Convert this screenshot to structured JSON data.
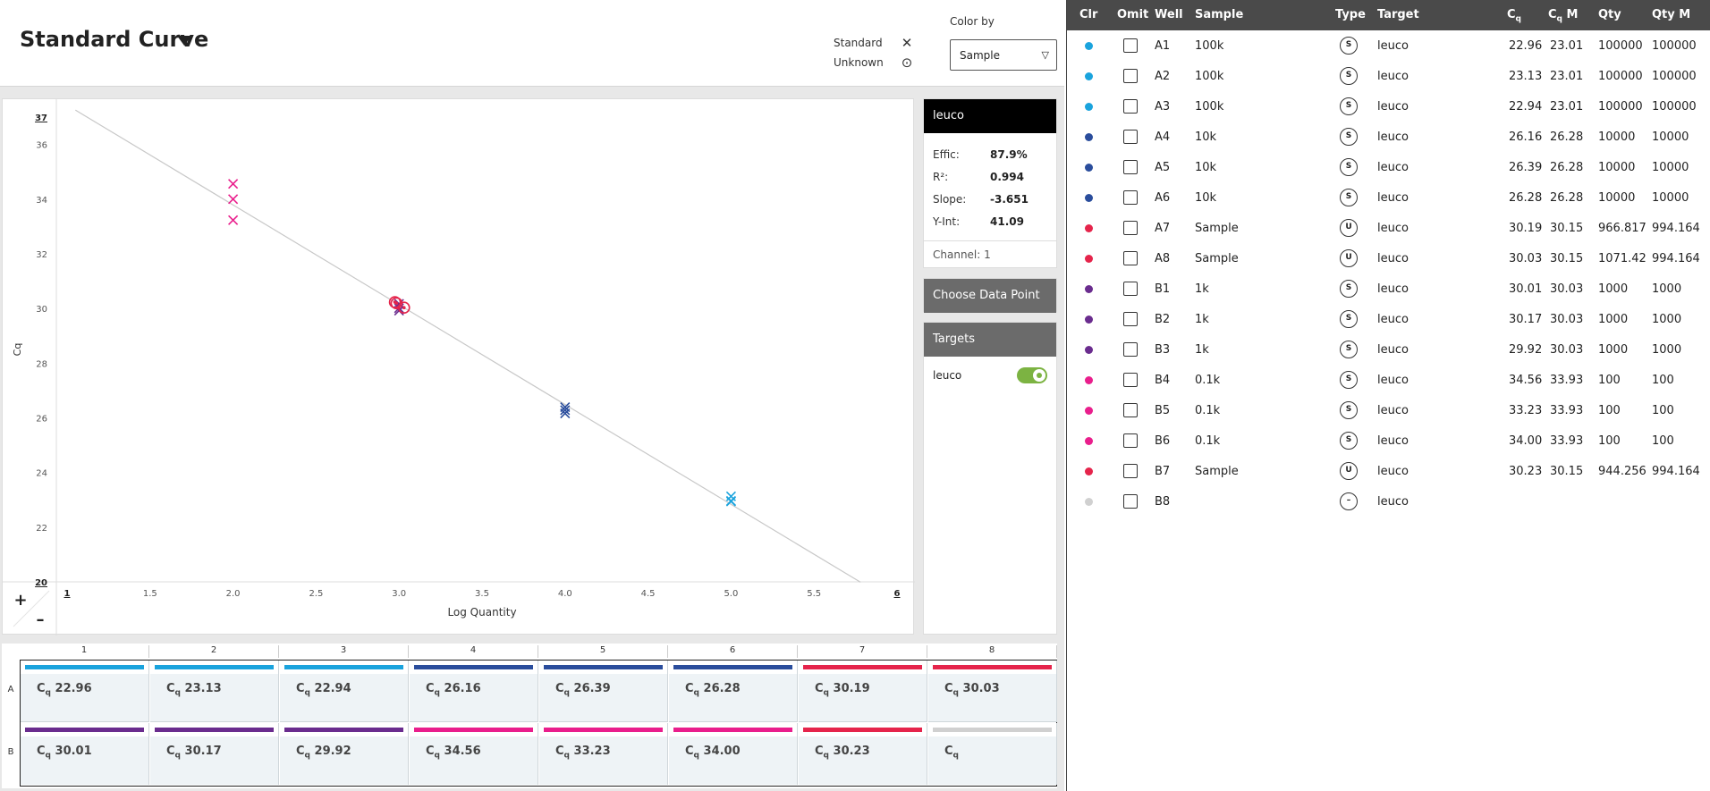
{
  "header": {
    "title": "Standard Curve",
    "legend": {
      "standard_label": "Standard",
      "unknown_label": "Unknown"
    },
    "color_by": {
      "label": "Color by",
      "value": "Sample"
    }
  },
  "side_panel": {
    "target_name": "leuco",
    "stats": [
      {
        "key": "Effic:",
        "value": "87.9%"
      },
      {
        "key": "R²:",
        "value": "0.994"
      },
      {
        "key": "Slope:",
        "value": "-3.651"
      },
      {
        "key": "Y-Int:",
        "value": "41.09"
      }
    ],
    "channel": "Channel: 1",
    "choose_point_label": "Choose Data Point",
    "targets_label": "Targets",
    "target_toggle": {
      "label": "leuco",
      "on": true
    }
  },
  "zoom": {
    "in": "+",
    "out": "–"
  },
  "chart_data": {
    "type": "scatter",
    "xlabel": "Log Quantity",
    "ylabel": "Cq",
    "xlim": [
      1,
      6
    ],
    "ylim": [
      20,
      37
    ],
    "x_ticks": [
      "1",
      "1.5",
      "2.0",
      "2.5",
      "3.0",
      "3.5",
      "4.0",
      "4.5",
      "5.0",
      "5.5",
      "6"
    ],
    "y_ticks": [
      "20",
      "22",
      "24",
      "26",
      "28",
      "30",
      "32",
      "34",
      "36",
      "37"
    ],
    "fit_line": {
      "slope": -3.651,
      "intercept": 41.09
    },
    "points": [
      {
        "x": 5.0,
        "y": 22.96,
        "type": "standard",
        "color": "#1aa3dd"
      },
      {
        "x": 5.0,
        "y": 23.13,
        "type": "standard",
        "color": "#1aa3dd"
      },
      {
        "x": 5.0,
        "y": 22.94,
        "type": "standard",
        "color": "#1aa3dd"
      },
      {
        "x": 4.0,
        "y": 26.16,
        "type": "standard",
        "color": "#2a4d9c"
      },
      {
        "x": 4.0,
        "y": 26.39,
        "type": "standard",
        "color": "#2a4d9c"
      },
      {
        "x": 4.0,
        "y": 26.28,
        "type": "standard",
        "color": "#2a4d9c"
      },
      {
        "x": 3.0,
        "y": 30.01,
        "type": "standard",
        "color": "#6a2c8e"
      },
      {
        "x": 3.0,
        "y": 30.17,
        "type": "standard",
        "color": "#6a2c8e"
      },
      {
        "x": 3.0,
        "y": 29.92,
        "type": "standard",
        "color": "#6a2c8e"
      },
      {
        "x": 2.0,
        "y": 34.56,
        "type": "standard",
        "color": "#e91e8c"
      },
      {
        "x": 2.0,
        "y": 33.23,
        "type": "standard",
        "color": "#e91e8c"
      },
      {
        "x": 2.0,
        "y": 34.0,
        "type": "standard",
        "color": "#e91e8c"
      },
      {
        "x": 2.985,
        "y": 30.19,
        "type": "unknown",
        "color": "#e5244b"
      },
      {
        "x": 3.03,
        "y": 30.03,
        "type": "unknown",
        "color": "#e5244b"
      },
      {
        "x": 2.975,
        "y": 30.23,
        "type": "unknown",
        "color": "#e5244b"
      }
    ]
  },
  "plate": {
    "columns": [
      "1",
      "2",
      "3",
      "4",
      "5",
      "6",
      "7",
      "8"
    ],
    "rows": [
      "A",
      "B"
    ],
    "wells": [
      [
        {
          "cq": " 22.96",
          "color": "#1aa3dd"
        },
        {
          "cq": " 23.13",
          "color": "#1aa3dd"
        },
        {
          "cq": " 22.94",
          "color": "#1aa3dd"
        },
        {
          "cq": " 26.16",
          "color": "#2a4d9c"
        },
        {
          "cq": " 26.39",
          "color": "#2a4d9c"
        },
        {
          "cq": " 26.28",
          "color": "#2a4d9c"
        },
        {
          "cq": " 30.19",
          "color": "#e5244b"
        },
        {
          "cq": " 30.03",
          "color": "#e5244b"
        }
      ],
      [
        {
          "cq": " 30.01",
          "color": "#6a2c8e"
        },
        {
          "cq": " 30.17",
          "color": "#6a2c8e"
        },
        {
          "cq": " 29.92",
          "color": "#6a2c8e"
        },
        {
          "cq": " 34.56",
          "color": "#e91e8c"
        },
        {
          "cq": " 33.23",
          "color": "#e91e8c"
        },
        {
          "cq": " 34.00",
          "color": "#e91e8c"
        },
        {
          "cq": " 30.23",
          "color": "#e5244b"
        },
        {
          "cq": "",
          "color": "#d0d0d0"
        }
      ]
    ]
  },
  "table": {
    "headers": {
      "clr": "Clr",
      "omit": "Omit",
      "well": "Well",
      "sample": "Sample",
      "type": "Type",
      "target": "Target",
      "cq": "C",
      "cq_m": "C",
      "qty": "Qty",
      "qty_m": "Qty M"
    },
    "rows": [
      {
        "color": "#1aa3dd",
        "well": "A1",
        "sample": "100k",
        "type": "S",
        "target": "leuco",
        "cq": "22.96",
        "cq_m": "23.01",
        "qty": "100000",
        "qty_m": "100000"
      },
      {
        "color": "#1aa3dd",
        "well": "A2",
        "sample": "100k",
        "type": "S",
        "target": "leuco",
        "cq": "23.13",
        "cq_m": "23.01",
        "qty": "100000",
        "qty_m": "100000"
      },
      {
        "color": "#1aa3dd",
        "well": "A3",
        "sample": "100k",
        "type": "S",
        "target": "leuco",
        "cq": "22.94",
        "cq_m": "23.01",
        "qty": "100000",
        "qty_m": "100000"
      },
      {
        "color": "#2a4d9c",
        "well": "A4",
        "sample": "10k",
        "type": "S",
        "target": "leuco",
        "cq": "26.16",
        "cq_m": "26.28",
        "qty": "10000",
        "qty_m": "10000"
      },
      {
        "color": "#2a4d9c",
        "well": "A5",
        "sample": "10k",
        "type": "S",
        "target": "leuco",
        "cq": "26.39",
        "cq_m": "26.28",
        "qty": "10000",
        "qty_m": "10000"
      },
      {
        "color": "#2a4d9c",
        "well": "A6",
        "sample": "10k",
        "type": "S",
        "target": "leuco",
        "cq": "26.28",
        "cq_m": "26.28",
        "qty": "10000",
        "qty_m": "10000"
      },
      {
        "color": "#e5244b",
        "well": "A7",
        "sample": "Sample",
        "type": "U",
        "target": "leuco",
        "cq": "30.19",
        "cq_m": "30.15",
        "qty": "966.817",
        "qty_m": "994.164"
      },
      {
        "color": "#e5244b",
        "well": "A8",
        "sample": "Sample",
        "type": "U",
        "target": "leuco",
        "cq": "30.03",
        "cq_m": "30.15",
        "qty": "1071.42",
        "qty_m": "994.164"
      },
      {
        "color": "#6a2c8e",
        "well": "B1",
        "sample": "1k",
        "type": "S",
        "target": "leuco",
        "cq": "30.01",
        "cq_m": "30.03",
        "qty": "1000",
        "qty_m": "1000"
      },
      {
        "color": "#6a2c8e",
        "well": "B2",
        "sample": "1k",
        "type": "S",
        "target": "leuco",
        "cq": "30.17",
        "cq_m": "30.03",
        "qty": "1000",
        "qty_m": "1000"
      },
      {
        "color": "#6a2c8e",
        "well": "B3",
        "sample": "1k",
        "type": "S",
        "target": "leuco",
        "cq": "29.92",
        "cq_m": "30.03",
        "qty": "1000",
        "qty_m": "1000"
      },
      {
        "color": "#e91e8c",
        "well": "B4",
        "sample": "0.1k",
        "type": "S",
        "target": "leuco",
        "cq": "34.56",
        "cq_m": "33.93",
        "qty": "100",
        "qty_m": "100"
      },
      {
        "color": "#e91e8c",
        "well": "B5",
        "sample": "0.1k",
        "type": "S",
        "target": "leuco",
        "cq": "33.23",
        "cq_m": "33.93",
        "qty": "100",
        "qty_m": "100"
      },
      {
        "color": "#e91e8c",
        "well": "B6",
        "sample": "0.1k",
        "type": "S",
        "target": "leuco",
        "cq": "34.00",
        "cq_m": "33.93",
        "qty": "100",
        "qty_m": "100"
      },
      {
        "color": "#e5244b",
        "well": "B7",
        "sample": "Sample",
        "type": "U",
        "target": "leuco",
        "cq": "30.23",
        "cq_m": "30.15",
        "qty": "944.256",
        "qty_m": "994.164"
      },
      {
        "color": "#d0d0d0",
        "well": "B8",
        "sample": "",
        "type": "–",
        "target": "leuco",
        "cq": "",
        "cq_m": "",
        "qty": "",
        "qty_m": ""
      }
    ]
  }
}
